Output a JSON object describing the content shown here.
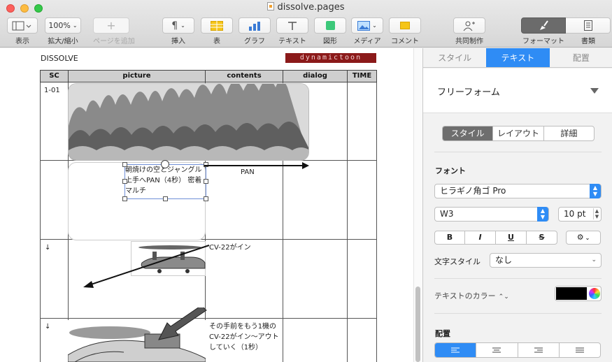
{
  "window": {
    "title": "dissolve.pages"
  },
  "toolbar": {
    "view": {
      "label": "表示"
    },
    "zoom": {
      "value": "100%",
      "label": "拡大/縮小"
    },
    "add_page": {
      "label": "ページを追加"
    },
    "insert": {
      "label": "挿入"
    },
    "table": {
      "label": "表"
    },
    "chart": {
      "label": "グラフ"
    },
    "text": {
      "label": "テキスト"
    },
    "shape": {
      "label": "図形"
    },
    "media": {
      "label": "メディア"
    },
    "comment": {
      "label": "コメント"
    },
    "collaborate": {
      "label": "共同制作"
    },
    "format": {
      "label": "フォーマット"
    },
    "document": {
      "label": "書類"
    }
  },
  "document": {
    "title": "DISSOLVE",
    "brand": "dynamictoon",
    "headers": [
      "SC",
      "picture",
      "contents",
      "dialog",
      "TIME"
    ],
    "rows": [
      {
        "sc": "1-01",
        "contents": ""
      },
      {
        "sc": "",
        "contents": "PAN"
      },
      {
        "sc": "↓",
        "contents": "CV-22がイン"
      },
      {
        "sc": "↓",
        "contents": "その手前をもう1機の CV-22がイン〜アウトしていく（1秒）"
      }
    ],
    "textbox": "朝焼けの空とジャングル 上手へPAN（4秒） 密着マルチ"
  },
  "inspector": {
    "tabs": [
      "スタイル",
      "テキスト",
      "配置"
    ],
    "active_tab": "テキスト",
    "paragraph_style": "フリーフォーム",
    "subtabs": [
      "スタイル",
      "レイアウト",
      "詳細"
    ],
    "active_subtab": "スタイル",
    "font_label": "フォント",
    "font_family": "ヒラギノ角ゴ Pro",
    "font_weight": "W3",
    "font_size": "10 pt",
    "bold": "B",
    "italic": "I",
    "underline": "U",
    "strike": "S",
    "char_style_label": "文字スタイル",
    "char_style_value": "なし",
    "text_color_label": "テキストのカラー",
    "text_color": "#000000",
    "alignment_label": "配置",
    "alignment_active": "left",
    "accent": "#2f8cf5"
  }
}
